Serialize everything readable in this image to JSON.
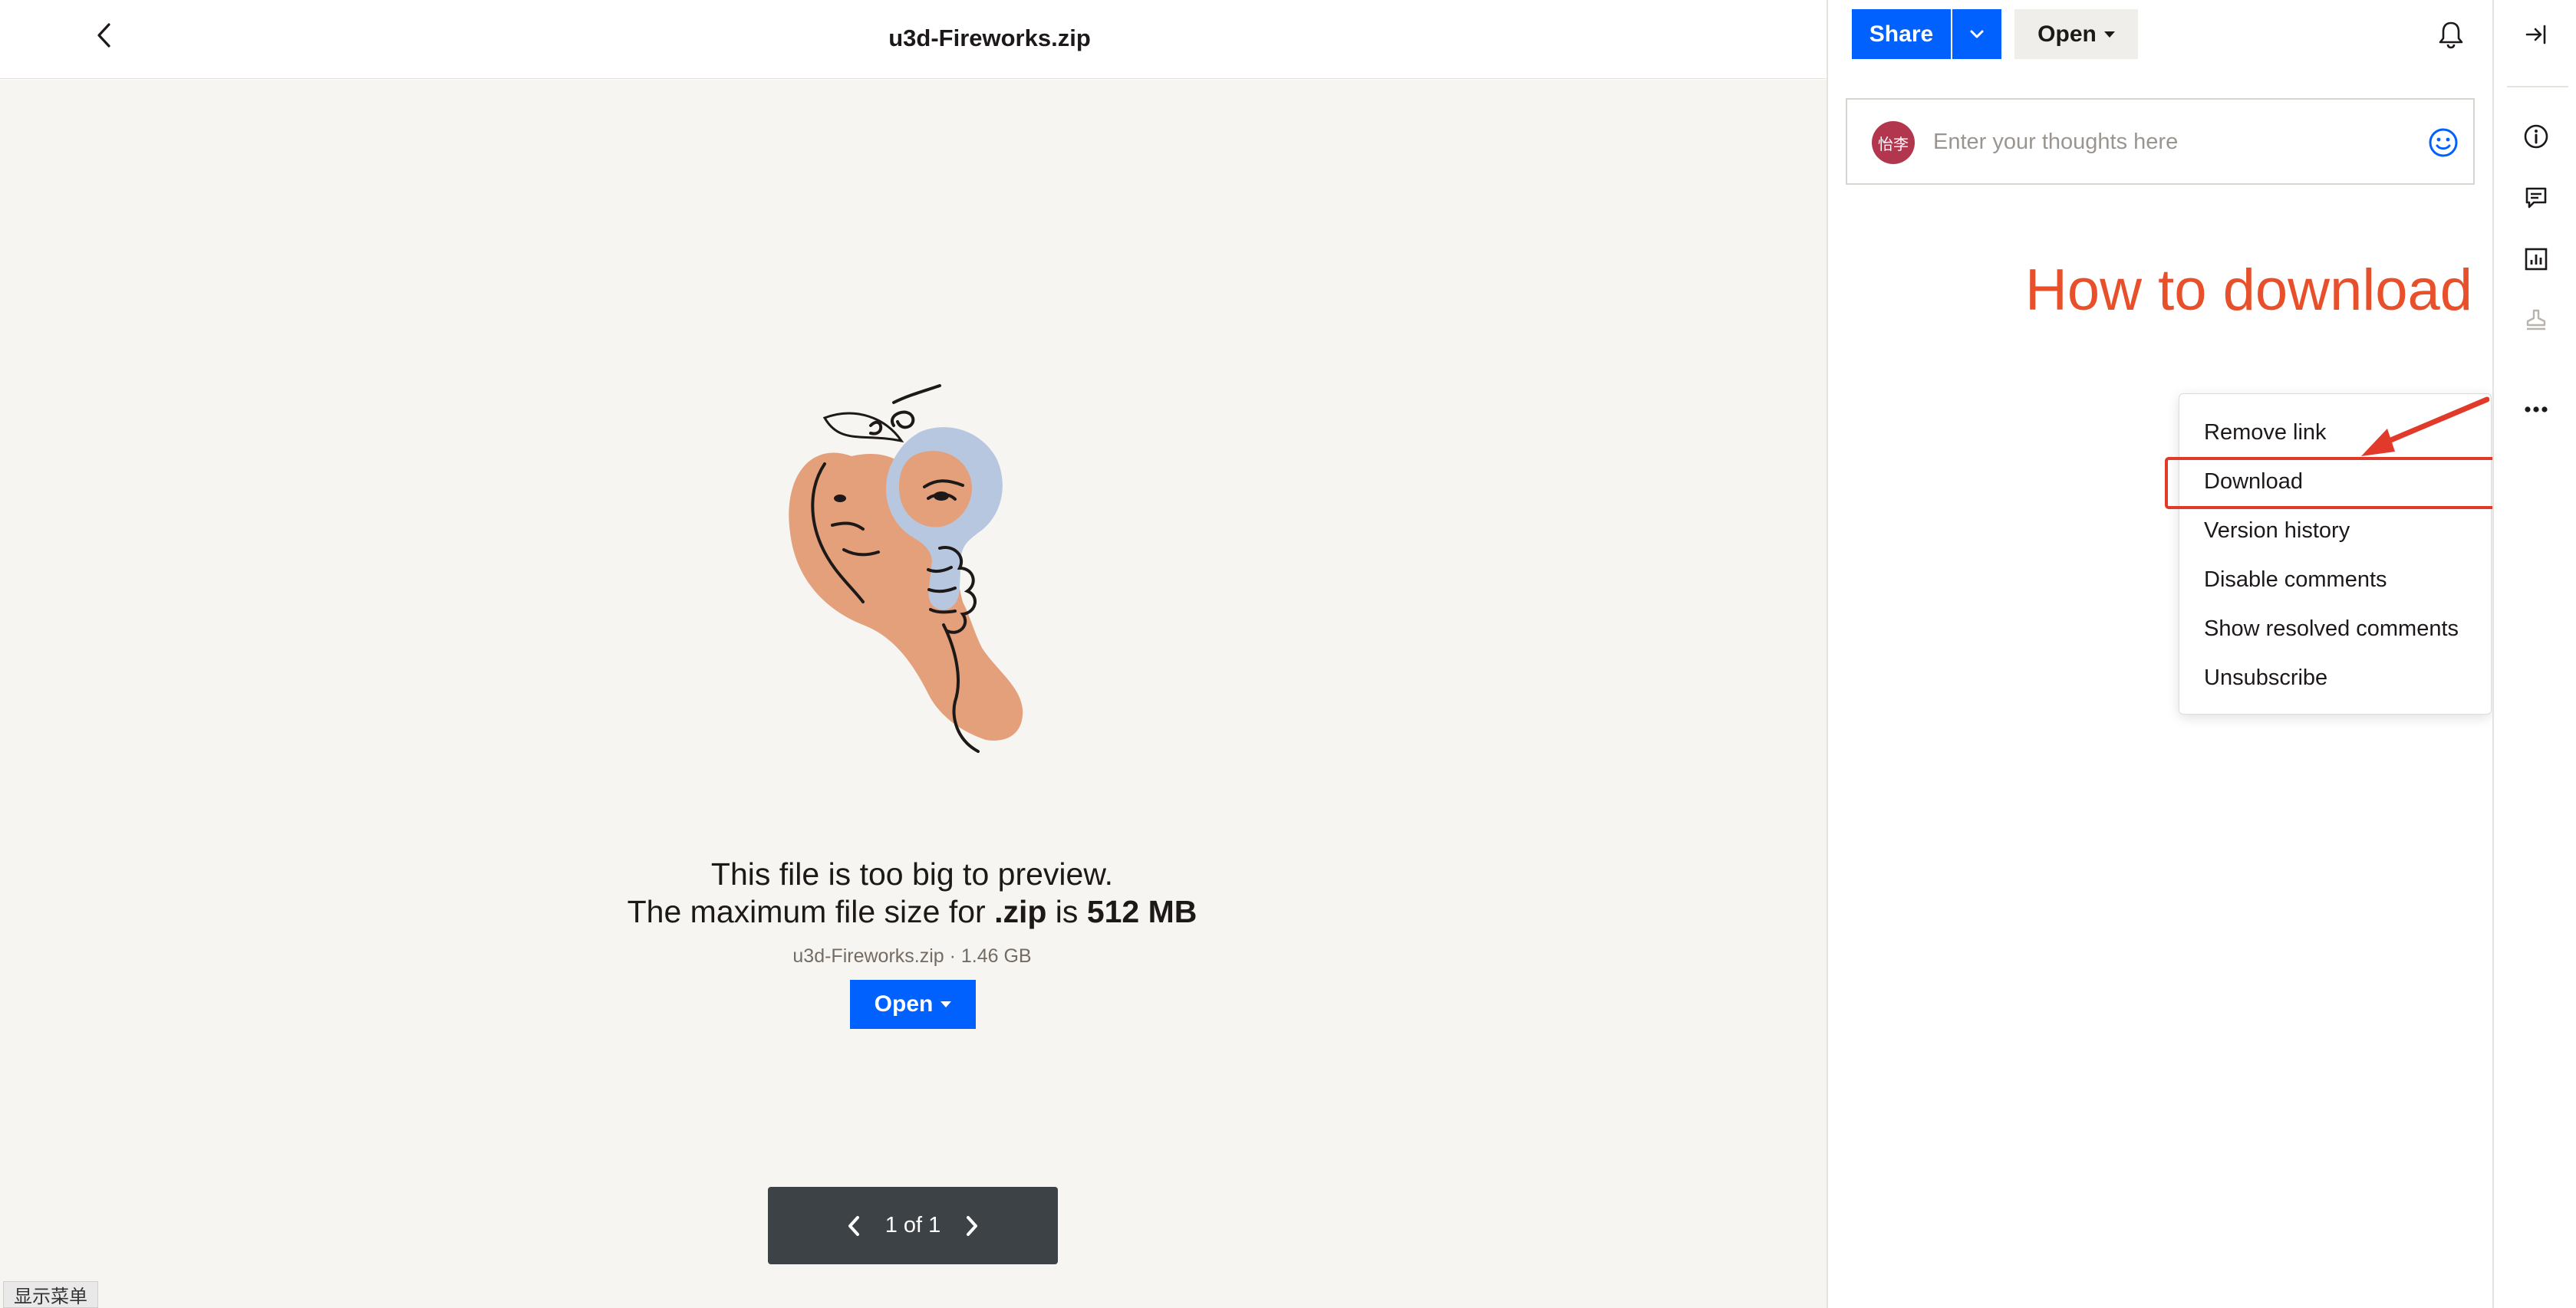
{
  "header": {
    "title": "u3d-Fireworks.zip"
  },
  "preview": {
    "message_line1": "This file is too big to preview.",
    "message_line2_prefix": "The maximum file size for ",
    "message_line2_ext": ".zip",
    "message_line2_mid": " is ",
    "message_line2_size": "512 MB",
    "file_info": "u3d-Fireworks.zip · 1.46 GB",
    "open_label": "Open",
    "pager_text": "1 of 1",
    "show_menu_label": "显示菜单"
  },
  "toolbar": {
    "share_label": "Share",
    "open_label": "Open"
  },
  "comment": {
    "avatar_text": "怡李",
    "placeholder": "Enter your thoughts here",
    "value": ""
  },
  "annotation": {
    "title": "How to download",
    "color": "#e8502c"
  },
  "menu": {
    "items": [
      "Remove link",
      "Download",
      "Version history",
      "Disable comments",
      "Show resolved comments",
      "Unsubscribe"
    ]
  },
  "rail": {
    "icons": [
      "collapse-panel-icon",
      "info-icon",
      "comment-icon",
      "activity-icon",
      "stamp-icon",
      "more-icon"
    ]
  },
  "colors": {
    "primary": "#0061fe",
    "highlight": "#e23a2a",
    "preview_bg": "#f7f5f2"
  }
}
